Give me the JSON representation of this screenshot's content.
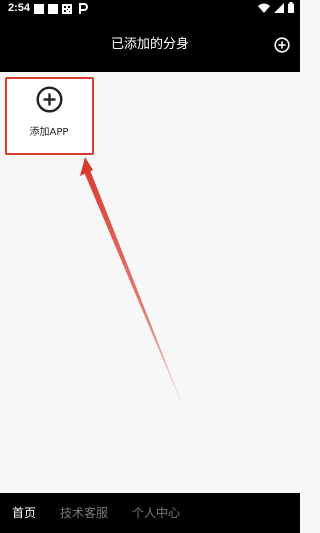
{
  "status_bar": {
    "time": "2:54",
    "notification_icons": [
      "square-icon",
      "square-icon",
      "qr-icon",
      "p-icon"
    ],
    "right_icons": [
      "wifi-icon",
      "signal-icon",
      "battery-icon"
    ]
  },
  "header": {
    "title": "已添加的分身",
    "add_icon": "plus-circle-icon"
  },
  "apps": {
    "add_tile_label": "添加APP",
    "add_tile_icon": "plus-circle-icon"
  },
  "annotation": {
    "highlight_color": "#d93a2f"
  },
  "bottom_nav": {
    "tabs": [
      {
        "label": "首页",
        "active": true
      },
      {
        "label": "技术客服",
        "active": false
      },
      {
        "label": "个人中心",
        "active": false
      }
    ]
  },
  "colors": {
    "bar_background": "#000000",
    "content_background": "#f7f7f7",
    "active_tab": "#ffffff",
    "inactive_tab": "#7a7a7a"
  }
}
